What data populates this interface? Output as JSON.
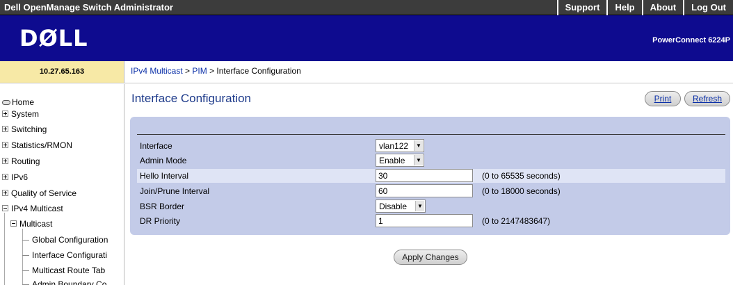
{
  "app": {
    "title": "Dell OpenManage Switch Administrator",
    "logo": "DØLL",
    "model": "PowerConnect 6224P",
    "ip": "10.27.65.163"
  },
  "toplinks": [
    "Support",
    "Help",
    "About",
    "Log Out"
  ],
  "breadcrumb": {
    "part1": "IPv4 Multicast",
    "sep1": " > ",
    "part2": "PIM",
    "sep2": " > ",
    "current": "Interface Configuration"
  },
  "sidebar": {
    "items": [
      "Home",
      "System",
      "Switching",
      "Statistics/RMON",
      "Routing",
      "IPv6",
      "Quality of Service",
      "IPv4 Multicast",
      "Multicast",
      "Global Configuration",
      "Interface Configurati",
      "Multicast Route Tab",
      "Admin Boundary Co"
    ]
  },
  "page": {
    "title": "Interface Configuration",
    "print": "Print",
    "refresh": "Refresh",
    "apply": "Apply Changes"
  },
  "form": {
    "interface": {
      "label": "Interface",
      "value": "vlan122"
    },
    "admin_mode": {
      "label": "Admin Mode",
      "value": "Enable"
    },
    "hello": {
      "label": "Hello Interval",
      "value": "30",
      "range": "(0 to 65535 seconds)"
    },
    "join_prune": {
      "label": "Join/Prune Interval",
      "value": "60",
      "range": "(0 to 18000 seconds)"
    },
    "bsr_border": {
      "label": "BSR Border",
      "value": "Disable"
    },
    "dr_priority": {
      "label": "DR Priority",
      "value": "1",
      "range": "(0 to 2147483647)"
    }
  }
}
